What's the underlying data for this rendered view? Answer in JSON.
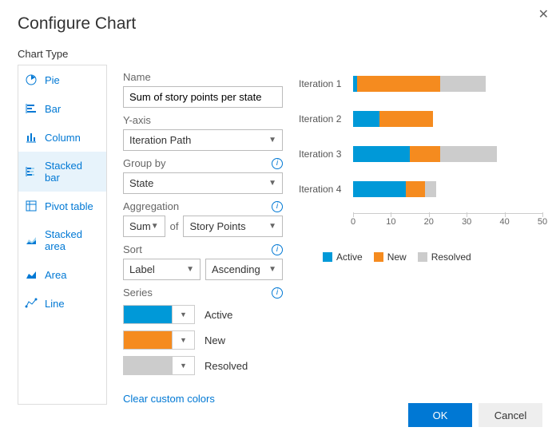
{
  "title": "Configure Chart",
  "labels": {
    "chart_type": "Chart Type",
    "name": "Name",
    "y_axis": "Y-axis",
    "group_by": "Group by",
    "aggregation": "Aggregation",
    "of": "of",
    "sort": "Sort",
    "series": "Series",
    "clear_colors": "Clear custom colors"
  },
  "chart_types": [
    {
      "id": "pie",
      "label": "Pie",
      "icon": "pie",
      "active": false
    },
    {
      "id": "bar",
      "label": "Bar",
      "icon": "bar-h",
      "active": false
    },
    {
      "id": "column",
      "label": "Column",
      "icon": "bar-v",
      "active": false
    },
    {
      "id": "stacked-bar",
      "label": "Stacked bar",
      "icon": "stacked-bar",
      "active": true
    },
    {
      "id": "pivot-table",
      "label": "Pivot table",
      "icon": "pivot",
      "active": false
    },
    {
      "id": "stacked-area",
      "label": "Stacked area",
      "icon": "stacked-area",
      "active": false
    },
    {
      "id": "area",
      "label": "Area",
      "icon": "area",
      "active": false
    },
    {
      "id": "line",
      "label": "Line",
      "icon": "line",
      "active": false
    }
  ],
  "config": {
    "name": "Sum of story points per state",
    "y_axis": "Iteration Path",
    "group_by": "State",
    "agg_func": "Sum",
    "agg_field": "Story Points",
    "sort_field": "Label",
    "sort_dir": "Ascending",
    "series": [
      {
        "name": "Active",
        "color": "#0099d8"
      },
      {
        "name": "New",
        "color": "#f58b1f"
      },
      {
        "name": "Resolved",
        "color": "#cccccc"
      }
    ]
  },
  "chart_data": {
    "type": "bar",
    "orientation": "horizontal",
    "stacked": true,
    "categories": [
      "Iteration 1",
      "Iteration 2",
      "Iteration 3",
      "Iteration 4"
    ],
    "series": [
      {
        "name": "Active",
        "color": "#0099d8",
        "values": [
          1,
          7,
          15,
          14
        ]
      },
      {
        "name": "New",
        "color": "#f58b1f",
        "values": [
          22,
          14,
          8,
          5
        ]
      },
      {
        "name": "Resolved",
        "color": "#cccccc",
        "values": [
          12,
          0,
          15,
          3
        ]
      }
    ],
    "x_ticks": [
      0,
      10,
      20,
      30,
      40,
      50
    ],
    "xlim": [
      0,
      50
    ],
    "xlabel": "",
    "ylabel": ""
  },
  "buttons": {
    "ok": "OK",
    "cancel": "Cancel"
  }
}
